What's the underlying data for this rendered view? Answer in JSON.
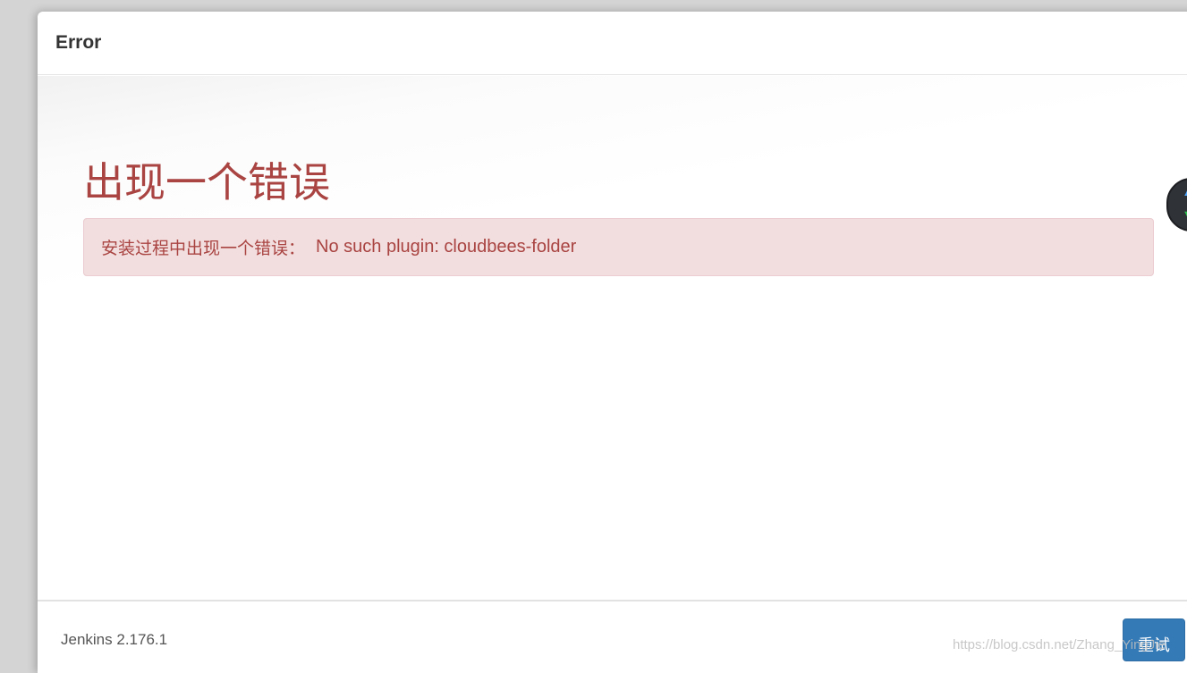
{
  "dialog": {
    "title": "Error"
  },
  "main": {
    "heading": "出现一个错误",
    "alert_prefix": "安装过程中出现一个错误：",
    "alert_message": "No such plugin: cloudbees-folder"
  },
  "footer": {
    "version": "Jenkins 2.176.1",
    "retry_label": "重试",
    "watermark": "https://blog.csdn.net/Zhang_YingJie"
  },
  "icons": {
    "widget_up": "arrow-up-icon",
    "widget_down": "arrow-down-icon"
  },
  "colors": {
    "error_text": "#a94442",
    "alert_bg": "#f2dede",
    "primary_button": "#337ab7"
  }
}
